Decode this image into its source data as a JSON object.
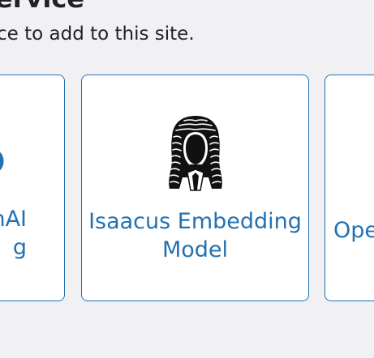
{
  "header": {
    "title": "ervice",
    "subtitle": "ce to add to this site."
  },
  "cards": [
    {
      "title_lines": [
        "nAI",
        "g"
      ],
      "icon": "openai-icon"
    },
    {
      "title_lines": [
        "Isaacus Embedding",
        "Model"
      ],
      "icon": "barrister-wig-icon"
    },
    {
      "title_lines": [
        "Ope"
      ],
      "icon": ""
    }
  ],
  "colors": {
    "accent": "#2271b1",
    "background": "#f1f1f4",
    "text": "#1d2327"
  }
}
